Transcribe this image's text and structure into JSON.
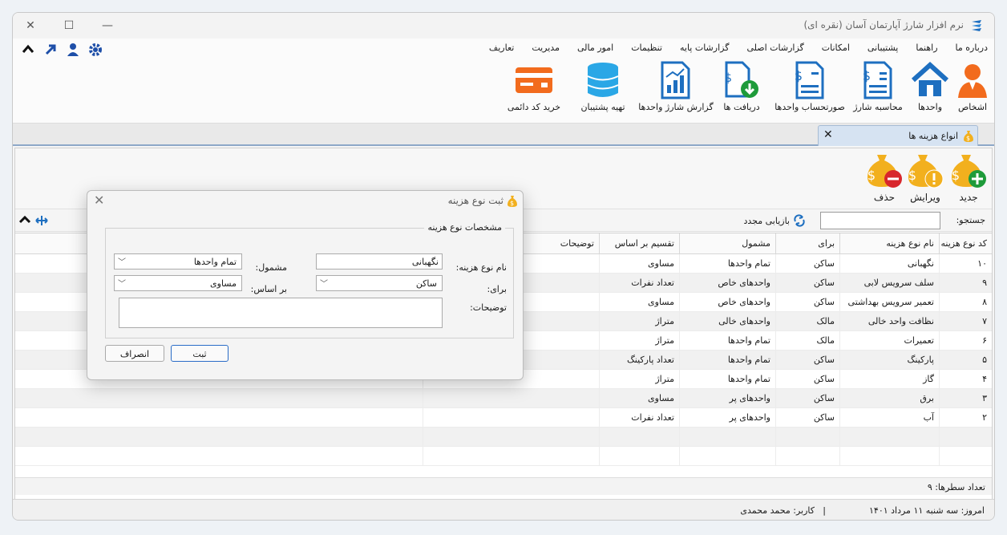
{
  "app": {
    "title": "نرم افزار شارژ آپارتمان آسان (نقره ای)"
  },
  "menu": [
    "تعاریف",
    "مدیریت",
    "امور مالی",
    "تنظیمات",
    "گزارشات پایه",
    "گزارشات اصلی",
    "امکانات",
    "پشتیبانی",
    "راهنما",
    "درباره ما"
  ],
  "quick_icons": [
    "gear-icon",
    "user-icon",
    "arrow-up-right-icon",
    "chevron-up-icon"
  ],
  "ribbon": [
    {
      "label": "اشخاص",
      "icon": "person-icon"
    },
    {
      "label": "واحدها",
      "icon": "house-icon"
    },
    {
      "label": "محاسبه شارژ",
      "icon": "invoice-icon"
    },
    {
      "label": "صورتحساب واحدها",
      "icon": "statement-icon"
    },
    {
      "label": "دریافت ها",
      "icon": "receipt-icon"
    },
    {
      "label": "گزارش شارژ واحدها",
      "icon": "chart-report-icon"
    },
    {
      "label": "تهیه پشتیبان",
      "icon": "database-icon"
    },
    {
      "label": "خرید کد دائمی",
      "icon": "credit-card-icon"
    }
  ],
  "tab": {
    "label": "انواع هزینه ها",
    "close": "×"
  },
  "toolbar": {
    "new": "جدید",
    "edit": "ویرایش",
    "delete": "حذف"
  },
  "search": {
    "label": "جستجو:",
    "value": "",
    "refresh": "بازیابی مجدد"
  },
  "columns": [
    "کد نوع هزینه",
    "نام نوع هزینه",
    "برای",
    "مشمول",
    "تقسیم بر اساس",
    "توضیحات"
  ],
  "rows": [
    [
      "۱۰",
      "نگهبانی",
      "ساکن",
      "تمام واحدها",
      "مساوی",
      ""
    ],
    [
      "۹",
      "سلف سرویس لابی",
      "ساکن",
      "واحدهای خاص",
      "تعداد نفرات",
      ""
    ],
    [
      "۸",
      "تعمیر سرویس بهداشتی",
      "ساکن",
      "واحدهای خاص",
      "مساوی",
      ""
    ],
    [
      "۷",
      "نظافت واحد خالی",
      "مالک",
      "واحدهای خالی",
      "متراژ",
      ""
    ],
    [
      "۶",
      "تعمیرات",
      "مالک",
      "تمام واحدها",
      "متراژ",
      ""
    ],
    [
      "۵",
      "پارکینگ",
      "ساکن",
      "تمام واحدها",
      "تعداد پارکینگ",
      ""
    ],
    [
      "۴",
      "گاز",
      "ساکن",
      "تمام واحدها",
      "متراژ",
      ""
    ],
    [
      "۳",
      "برق",
      "ساکن",
      "واحدهای پر",
      "مساوی",
      ""
    ],
    [
      "۲",
      "آب",
      "ساکن",
      "واحدهای پر",
      "تعداد نفرات",
      ""
    ]
  ],
  "footer": {
    "row_count": "تعداد سطرها:   ۹"
  },
  "status": {
    "today": "امروز: سه شنبه ۱۱ مرداد ۱۴۰۱",
    "separator": "|",
    "user": "کاربر: محمد محمدی"
  },
  "dialog": {
    "title": "ثبت نوع هزینه",
    "group": "مشخصات نوع هزینه",
    "name_label": "نام نوع هزینه:",
    "name_value": "نگهبانی",
    "inclusion_label": "مشمول:",
    "inclusion_value": "تمام واحدها",
    "for_label": "برای:",
    "for_value": "ساکن",
    "basis_label": "بر اساس:",
    "basis_value": "مساوی",
    "desc_label": "توضیحات:",
    "desc_value": "",
    "save": "ثبت",
    "cancel": "انصراف"
  },
  "colors": {
    "accent": "#1f5fbf",
    "icon_orange": "#f26b1d",
    "icon_blue": "#1e6fc0",
    "money_bag": "#f2b01e"
  }
}
